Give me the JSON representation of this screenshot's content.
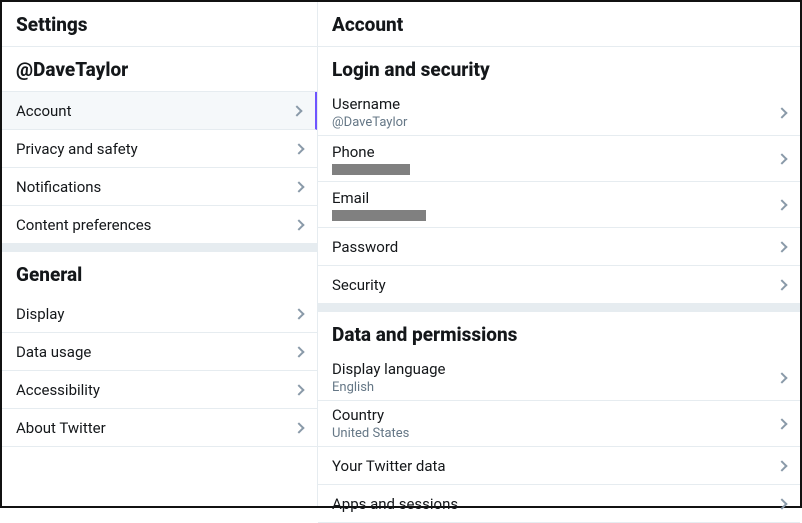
{
  "left": {
    "title": "Settings",
    "handle": "@DaveTaylor",
    "nav1": [
      {
        "label": "Account",
        "selected": true
      },
      {
        "label": "Privacy and safety"
      },
      {
        "label": "Notifications"
      },
      {
        "label": "Content preferences"
      }
    ],
    "generalLabel": "General",
    "nav2": [
      {
        "label": "Display"
      },
      {
        "label": "Data usage"
      },
      {
        "label": "Accessibility"
      },
      {
        "label": "About Twitter"
      }
    ]
  },
  "right": {
    "title": "Account",
    "sections": [
      {
        "label": "Login and security",
        "items": [
          {
            "label": "Username",
            "sub": "@DaveTaylor"
          },
          {
            "label": "Phone",
            "redactedWidth": 78
          },
          {
            "label": "Email",
            "redactedWidth": 94
          },
          {
            "label": "Password"
          },
          {
            "label": "Security"
          }
        ]
      },
      {
        "label": "Data and permissions",
        "items": [
          {
            "label": "Display language",
            "sub": "English"
          },
          {
            "label": "Country",
            "sub": "United States"
          },
          {
            "label": "Your Twitter data"
          },
          {
            "label": "Apps and sessions"
          }
        ]
      }
    ]
  }
}
